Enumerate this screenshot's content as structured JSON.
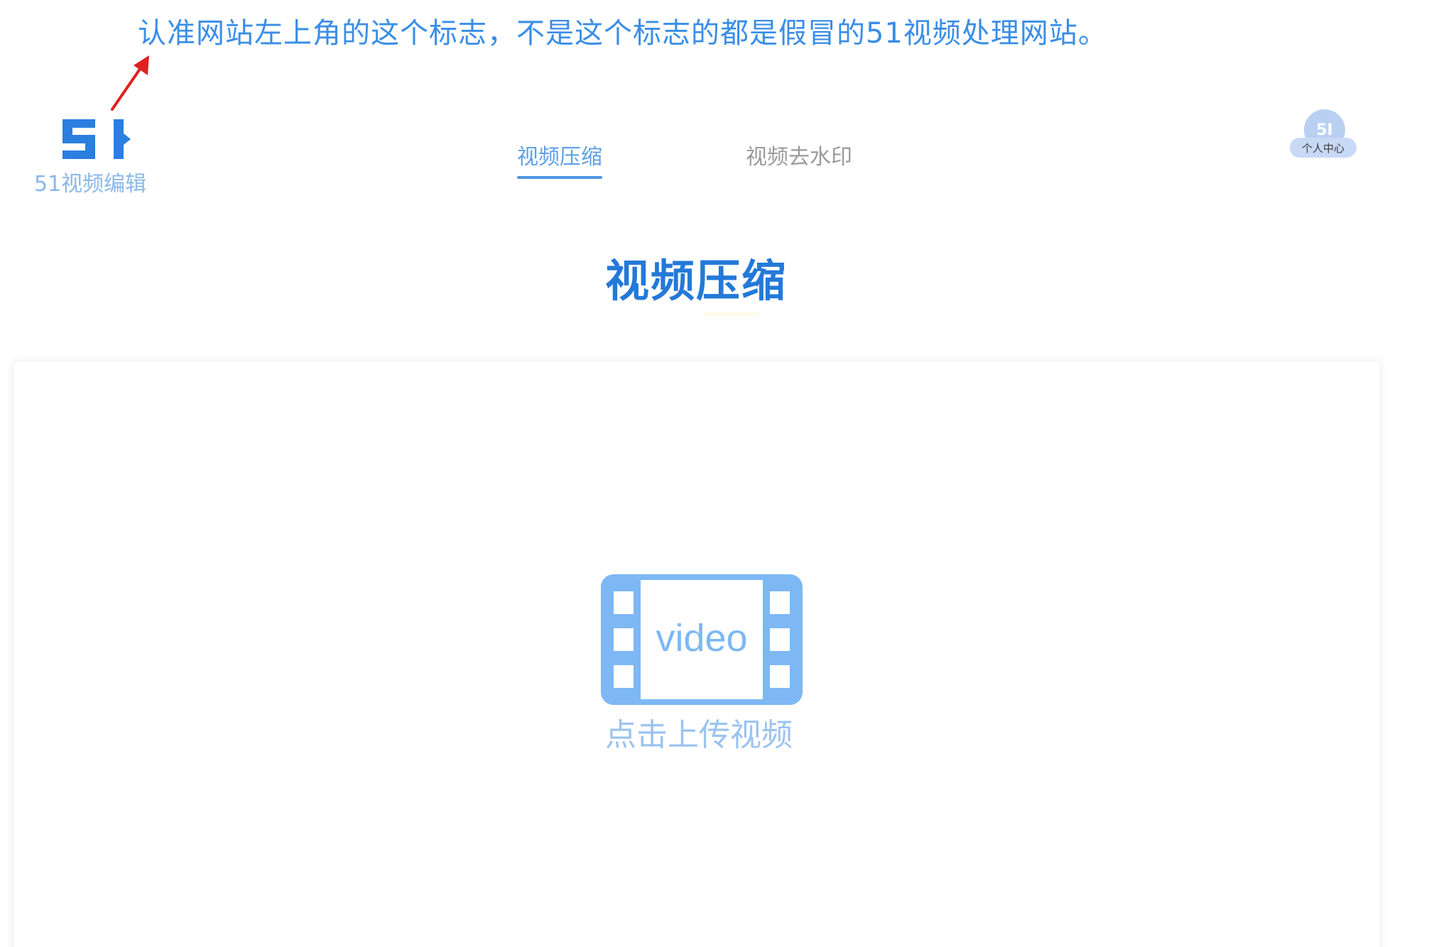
{
  "annotation": {
    "text": "认准网站左上角的这个标志，不是这个标志的都是假冒的51视频处理网站。"
  },
  "header": {
    "logo_mark": "5I",
    "logo_text": "51视频编辑",
    "tabs": [
      {
        "label": "视频压缩",
        "active": true
      },
      {
        "label": "视频去水印",
        "active": false
      }
    ],
    "user": {
      "avatar_text": "5I",
      "label": "个人中心"
    }
  },
  "main": {
    "heading": "视频压缩",
    "upload": {
      "icon_text": "video",
      "label": "点击上传视频"
    }
  },
  "colors": {
    "accent": "#2479d8",
    "tab_active": "#5ea0e6",
    "icon": "#7db8f5",
    "annotation_arrow": "#e02020"
  }
}
